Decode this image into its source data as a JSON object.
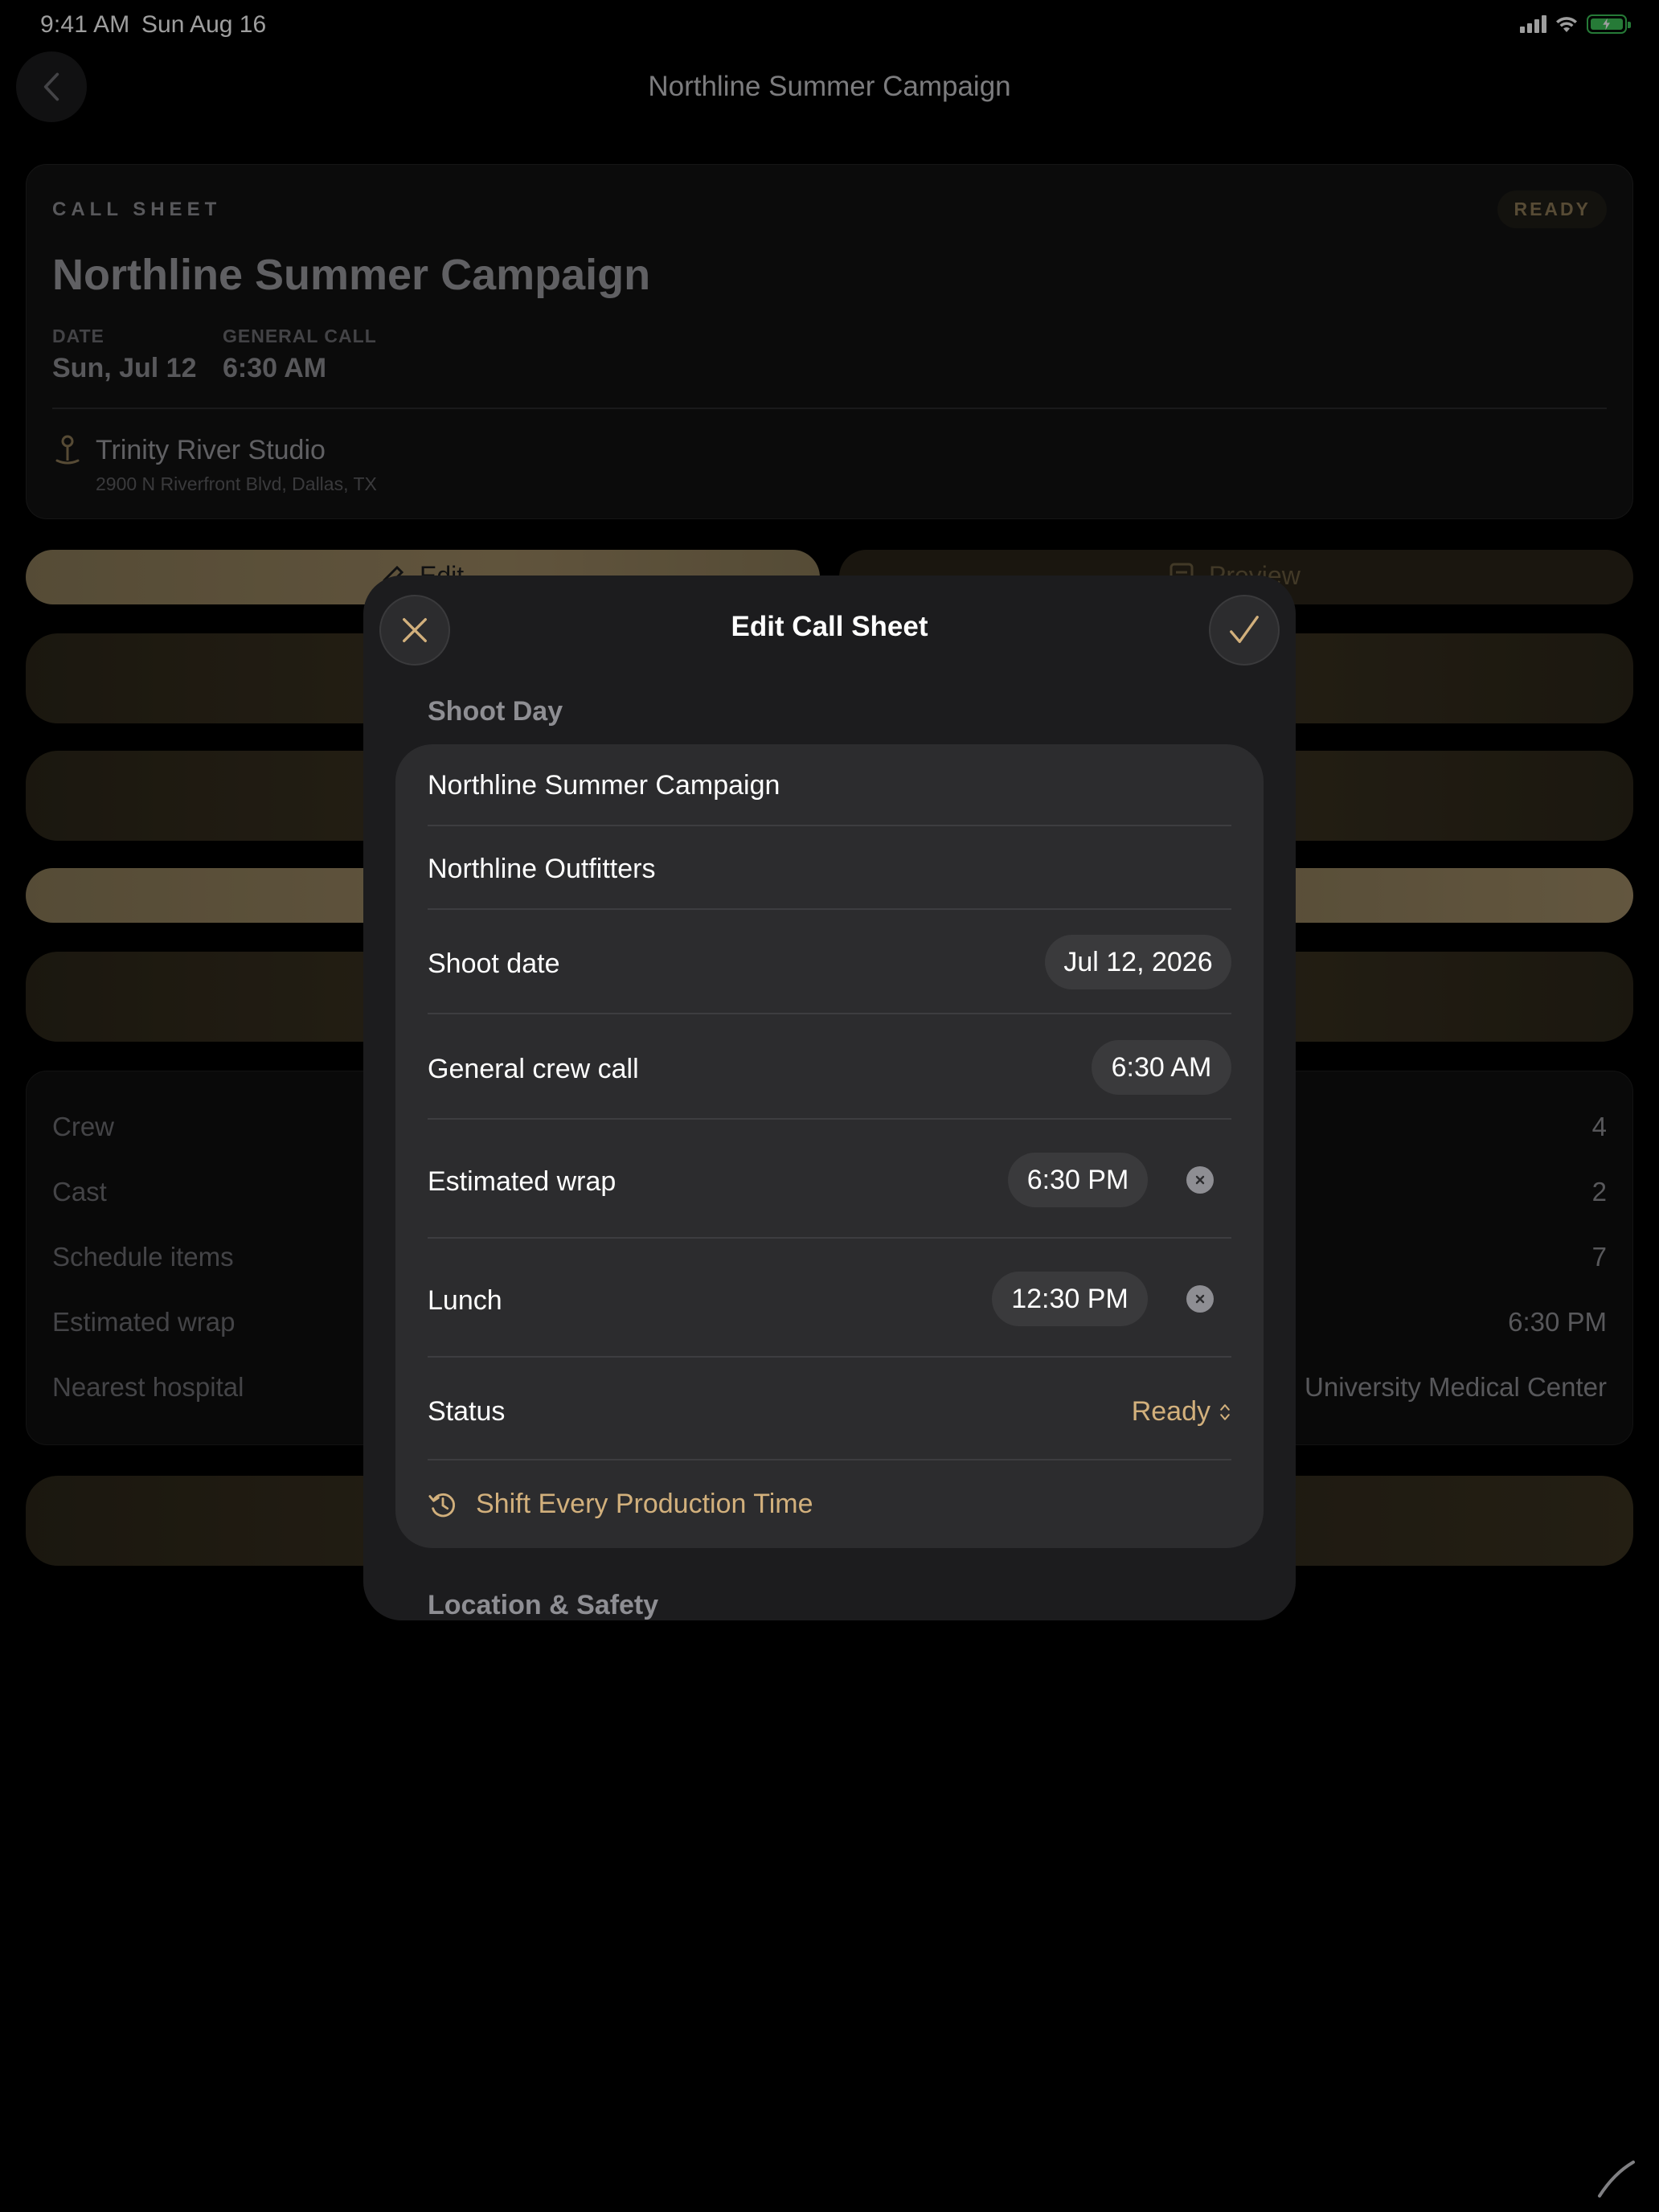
{
  "status_bar": {
    "time": "9:41 AM",
    "date": "Sun Aug 16"
  },
  "background": {
    "nav_title": "Northline Summer Campaign",
    "card": {
      "kicker": "CALL SHEET",
      "badge": "READY",
      "title": "Northline Summer Campaign",
      "date_label": "DATE",
      "date_value": "Sun, Jul 12",
      "call_label": "GENERAL CALL",
      "call_value": "6:30 AM",
      "location_name": "Trinity River Studio",
      "location_address": "2900 N Riverfront Blvd, Dallas, TX"
    },
    "edit_label": "Edit",
    "preview_label": "Preview",
    "stats": [
      {
        "label": "Crew",
        "value": "4"
      },
      {
        "label": "Cast",
        "value": "2"
      },
      {
        "label": "Schedule items",
        "value": "7"
      },
      {
        "label": "Estimated wrap",
        "value": "6:30 PM"
      },
      {
        "label": "Nearest hospital",
        "value": "University Medical Center"
      }
    ]
  },
  "modal": {
    "title": "Edit Call Sheet",
    "section_shoot_day": "Shoot Day",
    "project_name": "Northline Summer Campaign",
    "client_name": "Northline Outfitters",
    "shoot_date_label": "Shoot date",
    "shoot_date_value": "Jul 12, 2026",
    "crew_call_label": "General crew call",
    "crew_call_value": "6:30 AM",
    "wrap_label": "Estimated wrap",
    "wrap_value": "6:30 PM",
    "lunch_label": "Lunch",
    "lunch_value": "12:30 PM",
    "status_label": "Status",
    "status_value": "Ready",
    "shift_action": "Shift Every Production Time",
    "section_location": "Location & Safety"
  },
  "colors": {
    "accent_gold": "#d2b07c",
    "battery_green": "#3ec559"
  }
}
